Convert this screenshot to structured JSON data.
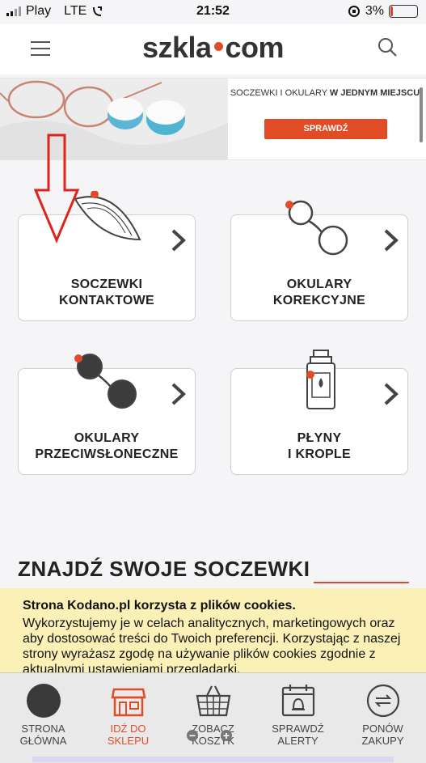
{
  "status_bar": {
    "carrier": "Play",
    "network": "LTE",
    "time": "21:52",
    "battery": "3%"
  },
  "header": {
    "logo_left": "szkla",
    "logo_right": "com",
    "menu_icon": "hamburger-icon",
    "search_icon": "search-icon"
  },
  "banner": {
    "text_normal": "SOCZEWKI I OKULARY ",
    "text_bold": "W JEDNYM MIEJSCU",
    "button": "SPRAWDŹ"
  },
  "categories": [
    {
      "line1": "SOCZEWKI",
      "line2": "KONTAKTOWE"
    },
    {
      "line1": "OKULARY",
      "line2": "KOREKCYJNE"
    },
    {
      "line1": "OKULARY",
      "line2": "PRZECIWSŁONECZNE"
    },
    {
      "line1": "PŁYNY",
      "line2": "I KROPLE"
    }
  ],
  "section_heading": "ZNAJDŹ SWOJE SOCZEWKI",
  "cookie": {
    "title": "Strona Kodano.pl korzysta z plików cookies.",
    "body": "Wykorzystujemy je w celach analitycznych, marketingowych oraz aby dostosować treści do Twoich preferencji. Korzystając z naszej strony wyrażasz zgodę na używanie plików cookies zgodnie z aktualnymi ustawieniami przeglądarki."
  },
  "bottom_nav": [
    {
      "line1": "STRONA",
      "line2": "GŁÓWNA"
    },
    {
      "line1": "IDŹ DO",
      "line2": "SKLEPU"
    },
    {
      "line1": "ZOBACZ",
      "line2": "KOSZYK"
    },
    {
      "line1": "SPRAWDŹ",
      "line2": "ALERTY"
    },
    {
      "line1": "PONÓW",
      "line2": "ZAKUPY"
    }
  ],
  "colors": {
    "accent": "#e14c26",
    "cookie_bg": "#fbf1b7",
    "annotation_arrow": "#e0231b"
  }
}
